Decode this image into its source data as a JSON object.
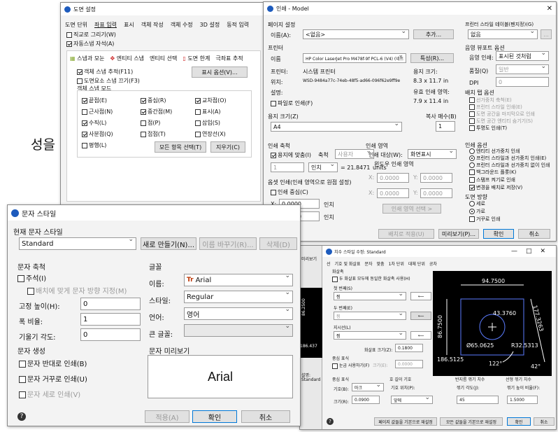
{
  "bg_text": "성을",
  "w1": {
    "title": "도면 설정",
    "tabs": [
      "도면 단위",
      "좌표 입력",
      "표시",
      "객체 작성",
      "객체 수정",
      "3D 설정",
      "동적 입력"
    ],
    "ortho": "직교로 그리기(W)",
    "ortho_on": false,
    "snap": "자동스냅 자석(A)",
    "snap_on": true,
    "subtabs": [
      "스냅과 모눈",
      "엔티티 스냅",
      "엔티티 선택",
      "도면 한계",
      "극좌표 추적"
    ],
    "track": "객체 스냅 추적(F11)",
    "track_on": true,
    "show_opts": "표시 옵션(V)...",
    "esnap_off": "도면요소 스냅 끄기(F3)",
    "esnap_off_on": false,
    "mode_label": "객체 스냅 모드",
    "modes": [
      {
        "l": "끝점(E)",
        "on": true
      },
      {
        "l": "중심(R)",
        "on": true
      },
      {
        "l": "교차점(O)",
        "on": true
      },
      {
        "l": "근사점(N)",
        "on": false
      },
      {
        "l": "중간점(M)",
        "on": true
      },
      {
        "l": "표시(A)",
        "on": false
      },
      {
        "l": "수직(L)",
        "on": true
      },
      {
        "l": "점(P)",
        "on": false
      },
      {
        "l": "삽입(S)",
        "on": false
      },
      {
        "l": "사분점(Q)",
        "on": true
      },
      {
        "l": "접점(T)",
        "on": false
      },
      {
        "l": "연장선(X)",
        "on": false
      },
      {
        "l": "평행(L)",
        "on": false
      }
    ],
    "select_all": "모든 항목 선택(T)",
    "clear": "지우기(C)"
  },
  "w2": {
    "title": "인쇄 - Model",
    "page_setup": "페이지 설정",
    "name_label": "이름(A):",
    "name_val": "<없음>",
    "add": "추가...",
    "printer": "프린터",
    "p_name_label": "이름",
    "p_name": "HP Color LaserJet Pro M478f-9f PCL-6 (V4) (네트",
    "props": "특성(R)...",
    "plotter_label": "프린터:",
    "plotter": "시스템 프린터",
    "loc_label": "위치:",
    "loc": "WSD-9484a77c-74eb-48f5-ad66-096f62e9ff9e",
    "desc_label": "설명:",
    "paper_dim_label": "용지 크기:",
    "paper_dim": "8.3 x 11.7 in",
    "printable_label": "유효 인쇄 영역:",
    "printable": "7.9 x 11.4 in",
    "to_file": "파일로 인쇄(F)",
    "paper_label": "용지 크기(Z)",
    "paper": "A4",
    "copies_label": "복사 매수(B)",
    "copies": "1",
    "scale_label": "인쇄 축척",
    "fit": "용지에 맞춤(I)",
    "scale": "축척",
    "custom": "사용자",
    "scale_v": "1",
    "unit": "인치",
    "unit_v": "= 21.8471",
    "units": "units",
    "area_label": "인쇄 영역",
    "target_label": "인쇄 대상(W):",
    "target": "화면표시",
    "window_area": "윈도우 인쇄 영역",
    "wx": "0.0000",
    "wy": "0.0000",
    "win_sel": "인쇄 영역 선택 >",
    "offset_label": "옵셋 인쇄(인쇄 영역으로 원점 설정)",
    "center": "인쇄 중심(C)",
    "ox": "0.0000",
    "oy": "0.0000",
    "inch": "인치",
    "style_label": "프린터 스타일 테이블(펜지정)(G)",
    "style": "없음",
    "shade_label": "음영 뷰포트 옵션",
    "shade_print_label": "음영 인쇄:",
    "shade_print": "표시된 것처럼",
    "quality_label": "품질(Q)",
    "quality": "일반",
    "dpi_label": "DPI",
    "dpi": "0",
    "bg_label": "배치 탭 옵션",
    "bg_opts": [
      "선가중치 축척(E)",
      "프린터 스타일 인쇄(E)",
      "도면 공간을 마지막으로 인쇄",
      "도면 공간 엔티티 숨기기(S)",
      "투명도 인쇄(T)"
    ],
    "print_opt_label": "인쇄 옵션",
    "print_opts": [
      "엔티티 선가중치 인쇄",
      "프린터 스타일과 선가중치 인쇄(E)",
      "프린터 스타일과 선가중치 없이 인쇄",
      "백그라운드 플롯(K)",
      "스탬프 켜기로 인쇄",
      "변경을 배치로 저장(V)"
    ],
    "orient_label": "도면 방향",
    "orient": [
      "세로",
      "가로",
      "거꾸로 인쇄"
    ],
    "apply": "배치로 적용(U)",
    "preview": "미리보기(P)...",
    "ok": "확인",
    "cancel": "취소"
  },
  "w3": {
    "title": "치수 스타일 수정: Standard",
    "tabs": [
      "선",
      "기호 및 화살표",
      "문자",
      "맞춤",
      "1차 단위",
      "대체 단위",
      "공차"
    ],
    "arrows": "화살촉",
    "same": "두 화살표 모두에 동일한 화살촉 사용(H)",
    "first": "첫 번째(S)",
    "second": "두 번째(E)",
    "leader": "지시선(L)",
    "fill": "찜",
    "size_label": "화살표 크기(Z):",
    "size": "0.1800",
    "cm_label": "중심 표식",
    "cm_use": "눈금 사용하기(F)",
    "cm_size": "크기(E):",
    "cm_v": "0.0000",
    "sym_label": "중심 표식",
    "type_label": "기호(B):",
    "type": "마크",
    "sz2": "크기(R):",
    "sz2v": "0.0900",
    "arc_label": "호 길이 기호",
    "arc_pos": "기호 위치(P):",
    "arc": "앞에",
    "jog_label": "반지름 꺾기 치수",
    "jog_ang": "꺾기 각도(J):",
    "jog": "45",
    "lin_label": "선형 꺾기 치수",
    "lin_h": "꺾기 높이 비율(F):",
    "lin": "1.5000",
    "b1": "페이지 값들을 기본으로 재설정",
    "b2": "모든 값들을 기본으로 재설정",
    "ok": "확인",
    "cancel": "취소",
    "side": "미리보기",
    "side2": "설명:",
    "side3": "Standard",
    "dims": [
      "94.7500",
      "43.3760",
      "86.7500",
      "177.3263",
      "Ø65.0625",
      "R32.5313",
      "186.5125",
      "122°",
      "42°",
      "86.2500",
      "186.437"
    ]
  },
  "w4": {
    "title": "문자 스타일",
    "cur_label": "현재 문자 스타일",
    "cur": "Standard",
    "new": "새로 만들기(N)...",
    "rename": "이름 바꾸기(R)...",
    "del": "삭제(D)",
    "measure": "문자 축척",
    "annot": "주석(I)",
    "annot_on": false,
    "match": "배치에 맞게 문자 방향 지정(M)",
    "height_label": "고정 높이(H):",
    "height": "0",
    "width_label": "폭 비율:",
    "width": "1",
    "oblique_label": "기울기 각도:",
    "oblique": "0",
    "font": "글꼴",
    "fname_label": "이름:",
    "fname": "Arial",
    "fstyle_label": "스타일:",
    "fstyle": "Regular",
    "lang_label": "언어:",
    "lang": "영어",
    "big_label": "큰 글꼴:",
    "gen": "문자 생성",
    "back": "문자 반대로 인쇄(B)",
    "upside": "문자 거꾸로 인쇄(U)",
    "vert": "문자 세로 인쇄(V)",
    "prev_label": "문자 미리보기",
    "prev": "Arial",
    "apply": "적용(A)",
    "ok": "확인",
    "cancel": "취소"
  }
}
